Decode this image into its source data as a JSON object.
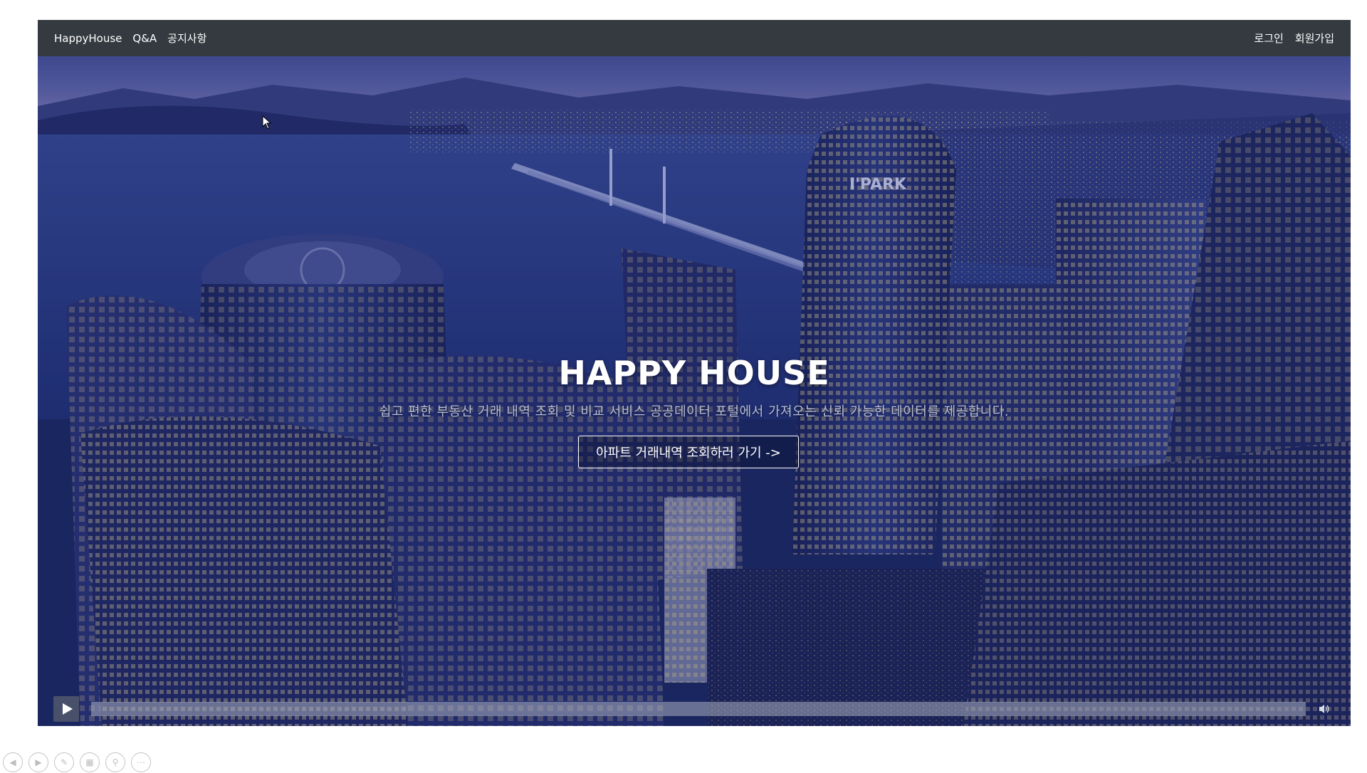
{
  "navbar": {
    "brand": "HappyHouse",
    "links": [
      "Q&A",
      "공지사항"
    ],
    "right_links": [
      "로그인",
      "회원가입"
    ]
  },
  "hero": {
    "title": "HAPPY HOUSE",
    "subtitle": "쉽고 편한 부동산 거래 내역 조회 및 비교 서비스 공공데이터 포털에서 가져오는 신뢰 가능한 데이터를 제공합니다.",
    "cta_label": "아파트 거래내역 조회하러 가기 ->",
    "background_tower_sign": "I'PARK"
  },
  "video": {
    "play_icon": "play-icon",
    "volume_icon": "volume-icon",
    "progress": 0
  },
  "presentation_toolbar": {
    "icons": [
      "prev-icon",
      "next-icon",
      "pen-icon",
      "slides-icon",
      "zoom-icon",
      "more-icon"
    ]
  },
  "colors": {
    "navbar_bg": "#343a40",
    "overlay": "#1d2a63",
    "text": "#ffffff"
  }
}
